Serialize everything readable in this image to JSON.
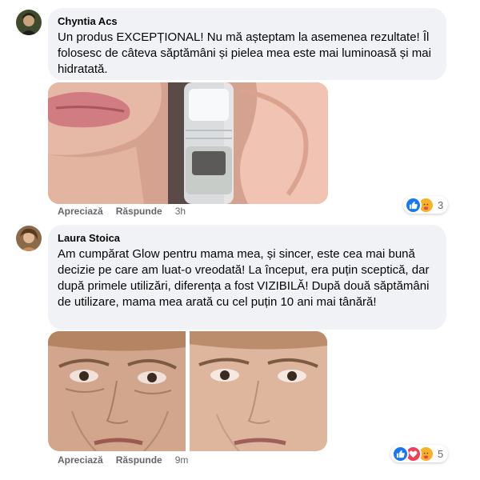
{
  "comments": [
    {
      "author": "Chyntia Acs",
      "text": "Un produs EXCEPȚIONAL! Nu mă așteptam la asemenea rezultate! Îl folosesc de câteva săptămâni și pielea mea este mai luminoasă și mai hidratată.",
      "like_label": "Apreciază",
      "reply_label": "Răspunde",
      "time": "3h",
      "reaction_icons": [
        "like-icon",
        "care-icon"
      ],
      "reaction_count": "3"
    },
    {
      "author": "Laura Stoica",
      "text": "Am cumpărat Glow pentru mama mea, și sincer, este cea mai bună decizie pe care am luat-o vreodată! La început, era puțin sceptică, dar după primele utilizări, diferența a fost VIZIBILĂ! După două săptămâni de utilizare, mama mea arată cu cel puțin 10 ani mai tânără!",
      "like_label": "Apreciază",
      "reply_label": "Răspunde",
      "time": "9m",
      "reaction_icons": [
        "like-icon",
        "love-icon",
        "care-icon"
      ],
      "reaction_count": "5"
    }
  ],
  "colors": {
    "bubble": "#f0f2f5",
    "meta_text": "#65676b",
    "like": "#1877f2",
    "love": "#f33e58",
    "care": "#f7b125"
  }
}
